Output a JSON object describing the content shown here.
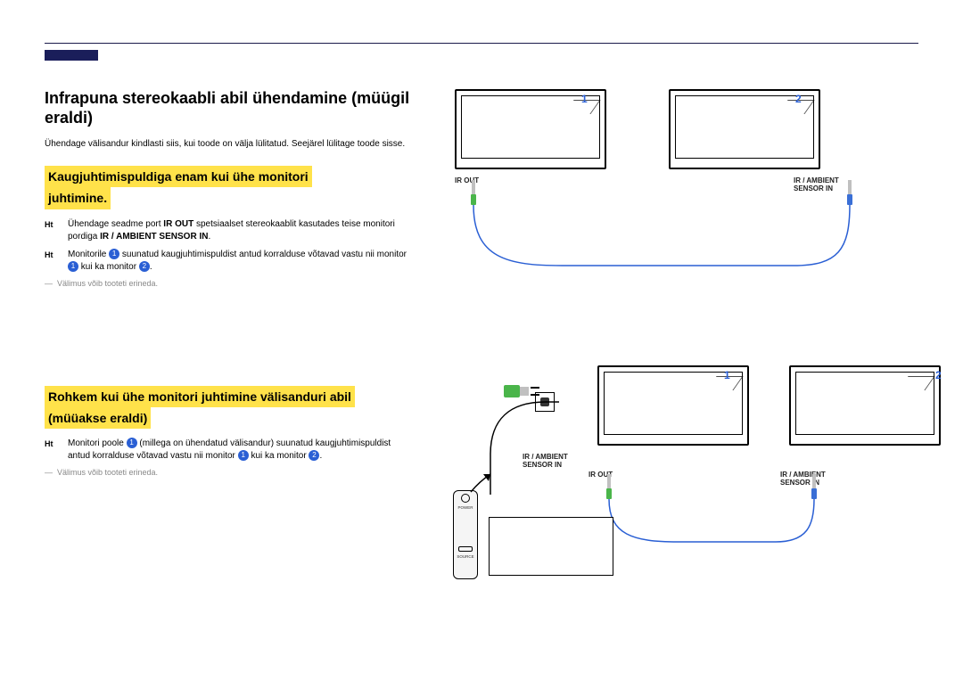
{
  "title": "Infrapuna stereokaabli abil ühendamine (müügil eraldi)",
  "intro": "Ühendage välisandur kindlasti siis, kui toode on välja lülitatud. Seejärel lülitage toode sisse.",
  "section1": {
    "heading_l1": "Kaugjuhtimispuldiga enam kui ühe monitori",
    "heading_l2": "juhtimine.",
    "bullet1_pre": "Ühendage seadme port ",
    "bullet1_mid": "IR OUT",
    "bullet1_mid2": " spetsiaalset stereokaablit kasutades teise monitori pordiga ",
    "bullet1_end": "IR / AMBIENT SENSOR IN",
    "bullet2_pre": "Monitorile ",
    "bullet2_mid": " suunatud kaugjuhtimispuldist antud korralduse võtavad vastu nii monitor ",
    "bullet2_mid2": " kui ka monitor ",
    "bullet_prefix": "Ht",
    "note": "Välimus võib tooteti erineda."
  },
  "section2": {
    "heading_l1": "Rohkem kui ühe monitori juhtimine välisanduri abil",
    "heading_l2": "(müüakse eraldi)",
    "bullet1_pre": "Monitori poole ",
    "bullet1_mid": " (millega on ühendatud välisandur) suunatud kaugjuhtimispuldist antud korralduse võtavad vastu nii monitor ",
    "bullet1_mid2": " kui ka monitor ",
    "bullet_prefix": "Ht",
    "note": "Välimus võib tooteti erineda."
  },
  "diagram1": {
    "num1": "1",
    "num2": "2",
    "label_irout": "IR OUT",
    "label_sensor": "IR / AMBIENT SENSOR IN"
  },
  "diagram2": {
    "num1": "1",
    "num2": "2",
    "label_irout": "IR OUT",
    "label_sensor1": "IR / AMBIENT SENSOR IN",
    "label_sensor2": "IR / AMBIENT SENSOR IN",
    "remote_power": "POWER",
    "remote_source": "SOURCE"
  },
  "nums": {
    "one": "1",
    "two": "2"
  },
  "dot": "."
}
